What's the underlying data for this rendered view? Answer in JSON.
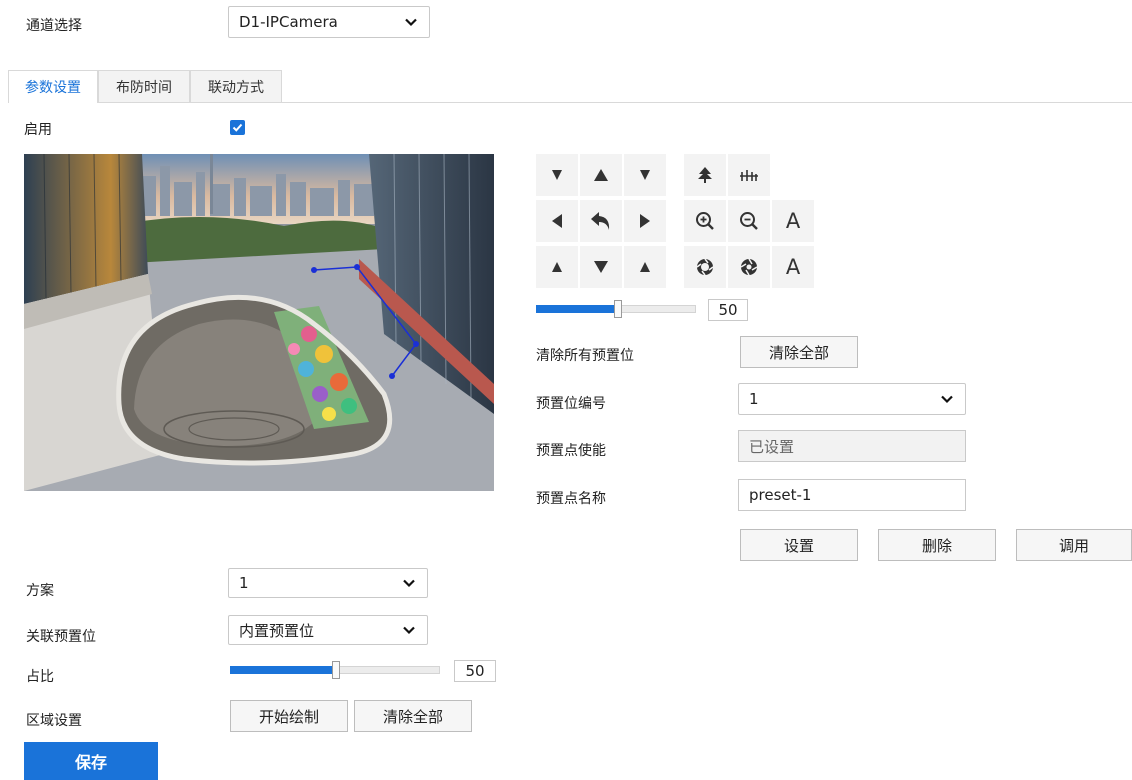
{
  "channel": {
    "label": "通道选择",
    "value": "D1-IPCamera"
  },
  "tabs": [
    {
      "label": "参数设置",
      "active": true
    },
    {
      "label": "布防时间",
      "active": false
    },
    {
      "label": "联动方式",
      "active": false
    }
  ],
  "enable": {
    "label": "启用",
    "checked": true
  },
  "ptz": {
    "speed_value": "50",
    "speed_fraction": 0.5,
    "iris_label_1": "A",
    "iris_label_2": "A"
  },
  "preset": {
    "clear_all_label": "清除所有预置位",
    "clear_all_button": "清除全部",
    "number_label": "预置位编号",
    "number_value": "1",
    "enable_label": "预置点使能",
    "enable_value": "已设置",
    "name_label": "预置点名称",
    "name_value": "preset-1",
    "set_button": "设置",
    "delete_button": "删除",
    "call_button": "调用"
  },
  "scheme": {
    "label": "方案",
    "value": "1"
  },
  "linked_preset": {
    "label": "关联预置位",
    "value": "内置预置位"
  },
  "ratio": {
    "label": "占比",
    "value": "50",
    "fraction": 0.5
  },
  "region": {
    "label": "区域设置",
    "start_button": "开始绘制",
    "clear_button": "清除全部"
  },
  "save_button": "保存",
  "colors": {
    "accent": "#1a73d9",
    "polyline": "#1a2fd6"
  }
}
